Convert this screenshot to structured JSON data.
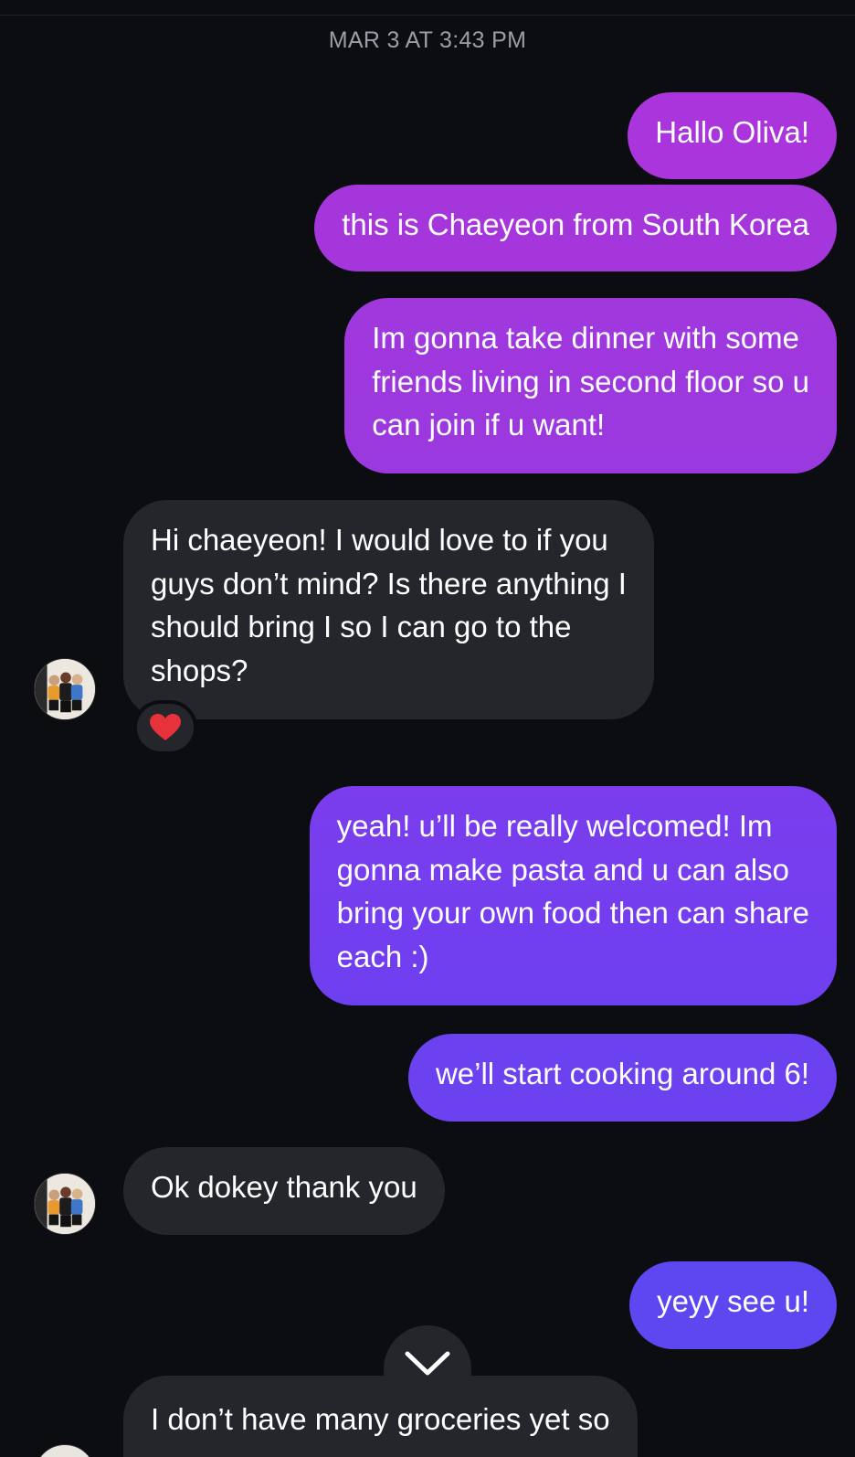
{
  "conversation": {
    "timestamp": "MAR 3 AT 3:43 PM",
    "messages": [
      {
        "sender": "me",
        "text": "Hallo Oliva!"
      },
      {
        "sender": "me",
        "text": "this is Chaeyeon from South Korea"
      },
      {
        "sender": "me",
        "lines": [
          "Im gonna take dinner with some",
          "friends living in second floor so u",
          "can join if u want!"
        ]
      },
      {
        "sender": "them",
        "lines": [
          "Hi chaeyeon! I would love to if you",
          "guys don’t mind? Is there anything I",
          "should bring I so I can go to the",
          "shops?"
        ],
        "reaction": "❤️"
      },
      {
        "sender": "me",
        "lines": [
          "yeah! u’ll be really welcomed! Im",
          "gonna make pasta and u can also",
          "bring your own food then can share",
          "each :)"
        ]
      },
      {
        "sender": "me",
        "text": "we’ll start cooking around 6!"
      },
      {
        "sender": "them",
        "text": "Ok dokey thank you"
      },
      {
        "sender": "me",
        "text": "yeyy see u!"
      },
      {
        "sender": "them",
        "text": "I don’t have many groceries yet so"
      }
    ]
  },
  "icons": {
    "scroll_down": "chevron-down-icon",
    "avatar": "contact-avatar",
    "reaction": "heart-icon"
  },
  "colors": {
    "background": "#0b0d11",
    "incoming_bubble": "#24262b",
    "outgoing_gradient_top": "#a435db",
    "outgoing_gradient_bottom": "#5a43f0",
    "timestamp_text": "#9a9ea6"
  }
}
